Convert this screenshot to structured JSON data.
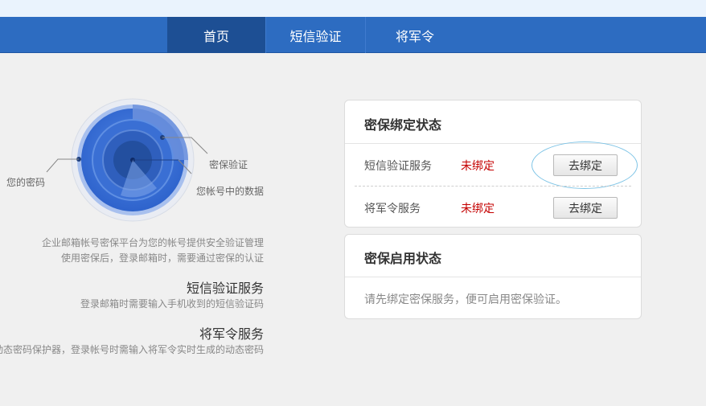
{
  "nav": {
    "items": [
      {
        "label": "首页",
        "active": true
      },
      {
        "label": "短信验证",
        "active": false
      },
      {
        "label": "将军令",
        "active": false
      }
    ]
  },
  "illustration": {
    "label_password": "您的密码",
    "label_security": "密保验证",
    "label_data": "您帐号中的数据"
  },
  "intro": {
    "line1": "企业邮箱帐号密保平台为您的帐号提供安全验证管理",
    "line2": "使用密保后，登录邮箱时，需要通过密保的认证"
  },
  "features": [
    {
      "title": "短信验证服务",
      "desc": "登录邮箱时需要输入手机收到的短信验证码"
    },
    {
      "title": "将军令服务",
      "desc": "动态密码保护器，登录帐号时需输入将军令实时生成的动态密码"
    }
  ],
  "bind_card": {
    "title": "密保绑定状态",
    "rows": [
      {
        "label": "短信验证服务",
        "status": "未绑定",
        "button": "去绑定"
      },
      {
        "label": "将军令服务",
        "status": "未绑定",
        "button": "去绑定"
      }
    ]
  },
  "enable_card": {
    "title": "密保启用状态",
    "hint": "请先绑定密保服务，便可启用密保验证。"
  },
  "colors": {
    "nav_bg": "#2d6cc1",
    "nav_active": "#1d4f94",
    "status_red": "#c40000"
  }
}
